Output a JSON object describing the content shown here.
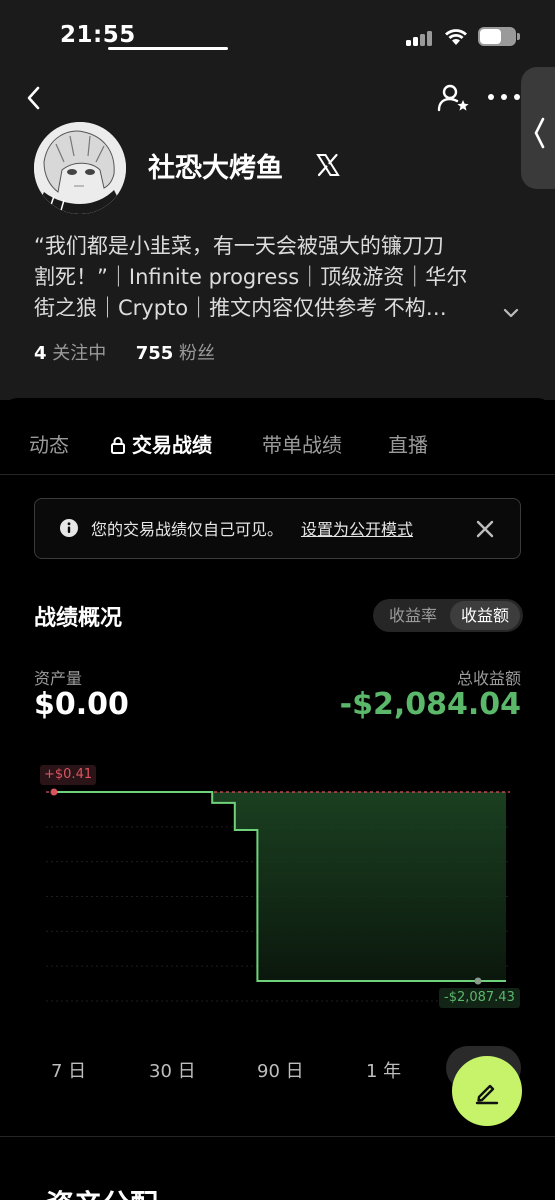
{
  "status_bar": {
    "time": "21:55"
  },
  "profile": {
    "username": "社恐大烤鱼",
    "bio_lines": [
      "“我们都是小韭菜，有一天会被强大的镰刀刀",
      "割死！”｜Infinite progress｜顶级游资｜华尔",
      "街之狼｜Crypto｜推文内容仅供参考 不构…"
    ],
    "following_count": "4",
    "following_label": "关注中",
    "followers_count": "755",
    "followers_label": "粉丝"
  },
  "tabs": [
    {
      "label": "动态",
      "active": false
    },
    {
      "label": "交易战绩",
      "active": true,
      "locked": true
    },
    {
      "label": "带单战绩",
      "active": false
    },
    {
      "label": "直播",
      "active": false
    }
  ],
  "notice": {
    "text": "您的交易战绩仅自己可见。",
    "link": "设置为公开模式"
  },
  "overview": {
    "title": "战绩概况",
    "toggle_options": [
      "收益率",
      "收益额"
    ],
    "toggle_selected": "收益额",
    "asset_label": "资产量",
    "asset_value": "$0.00",
    "pnl_label": "总收益额",
    "pnl_value": "-$2,084.04",
    "pnl_color": "#5bb86b"
  },
  "chart_data": {
    "type": "area",
    "title": "",
    "xlabel": "",
    "ylabel": "",
    "max_label": "+$0.41",
    "min_label": "-$2,087.43",
    "ylim": [
      -2087.43,
      0.41
    ],
    "values": [
      0.41,
      0.41,
      0,
      0,
      0,
      0,
      0,
      -120,
      -420,
      -2087.43,
      -2087.43,
      -2087.43,
      -2087.43,
      -2087.43,
      -2087.43,
      -2087.43,
      -2087.43,
      -2087.43,
      -2087.43,
      -2087.43,
      -2087.43
    ],
    "line_color": "#6fd27a",
    "max_color": "#d9545f",
    "grid": true,
    "reference_line": 0.41
  },
  "time_ranges": [
    "7 日",
    "30 日",
    "90 日",
    "1 年"
  ],
  "next_section_title": "资产分配"
}
